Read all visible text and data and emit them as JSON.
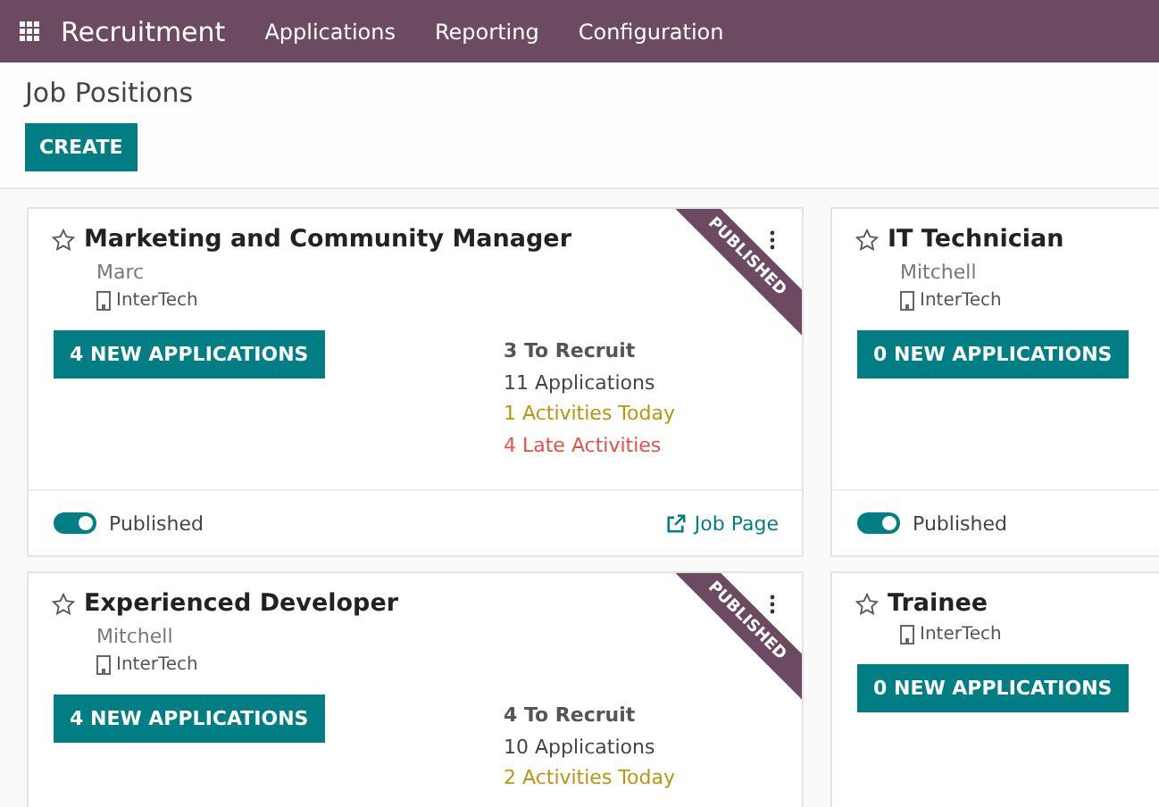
{
  "navbar": {
    "app_title": "Recruitment",
    "menu": [
      "Applications",
      "Reporting",
      "Configuration"
    ]
  },
  "page": {
    "title": "Job Positions",
    "create_button": "CREATE"
  },
  "jobs": [
    {
      "title": "Marketing and Community Manager",
      "favorite": false,
      "owner": "Marc",
      "company": "InterTech",
      "ribbon": "PUBLISHED",
      "new_applications": "4 NEW APPLICATIONS",
      "stats": [
        {
          "kind": "recruit",
          "text": "3 To Recruit"
        },
        {
          "kind": "applications",
          "text": "11 Applications"
        },
        {
          "kind": "today",
          "text": "1 Activities Today"
        },
        {
          "kind": "late",
          "text": "4 Late Activities"
        }
      ],
      "footer": {
        "published_label": "Published",
        "published": true,
        "job_page": "Job Page"
      }
    },
    {
      "title": "IT Technician",
      "favorite": false,
      "owner": "Mitchell",
      "company": "InterTech",
      "new_applications": "0 NEW APPLICATIONS",
      "footer": {
        "published_label": "Published",
        "published": true
      }
    },
    {
      "title": "Experienced Developer",
      "favorite": false,
      "owner": "Mitchell",
      "company": "InterTech",
      "ribbon": "PUBLISHED",
      "new_applications": "4 NEW APPLICATIONS",
      "stats": [
        {
          "kind": "recruit",
          "text": "4 To Recruit"
        },
        {
          "kind": "applications",
          "text": "10 Applications"
        },
        {
          "kind": "today",
          "text": "2 Activities Today"
        }
      ]
    },
    {
      "title": "Trainee",
      "favorite": false,
      "company": "InterTech",
      "new_applications": "0 NEW APPLICATIONS"
    }
  ]
}
